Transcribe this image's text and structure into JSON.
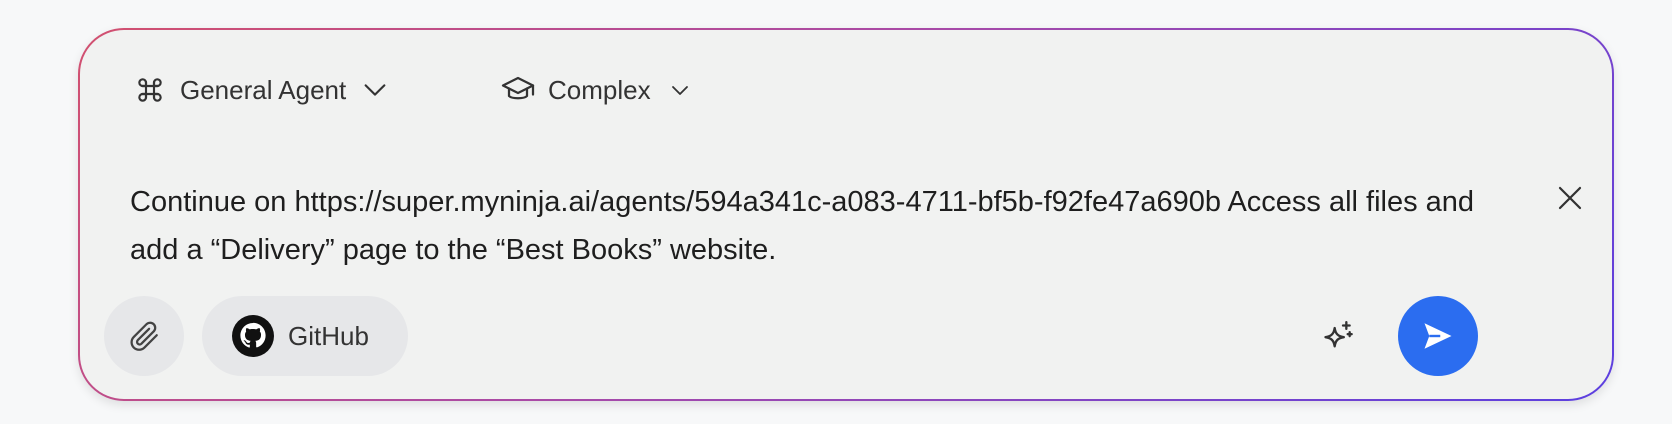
{
  "composer": {
    "agent_selector": {
      "label": "General Agent",
      "icon": "command-icon"
    },
    "mode_selector": {
      "label": "Complex",
      "icon": "graduation-cap-icon"
    },
    "prompt_text": "Continue on https://super.myninja.ai/agents/594a341c-a083-4711-bf5b-f92fe47a690b Access all files and add a “Delivery” page to the “Best Books” website.",
    "github_button_label": "GitHub",
    "colors": {
      "send_button": "#2b6df0",
      "border_gradient_start": "#d2506f",
      "border_gradient_end": "#5b3fe0"
    }
  }
}
